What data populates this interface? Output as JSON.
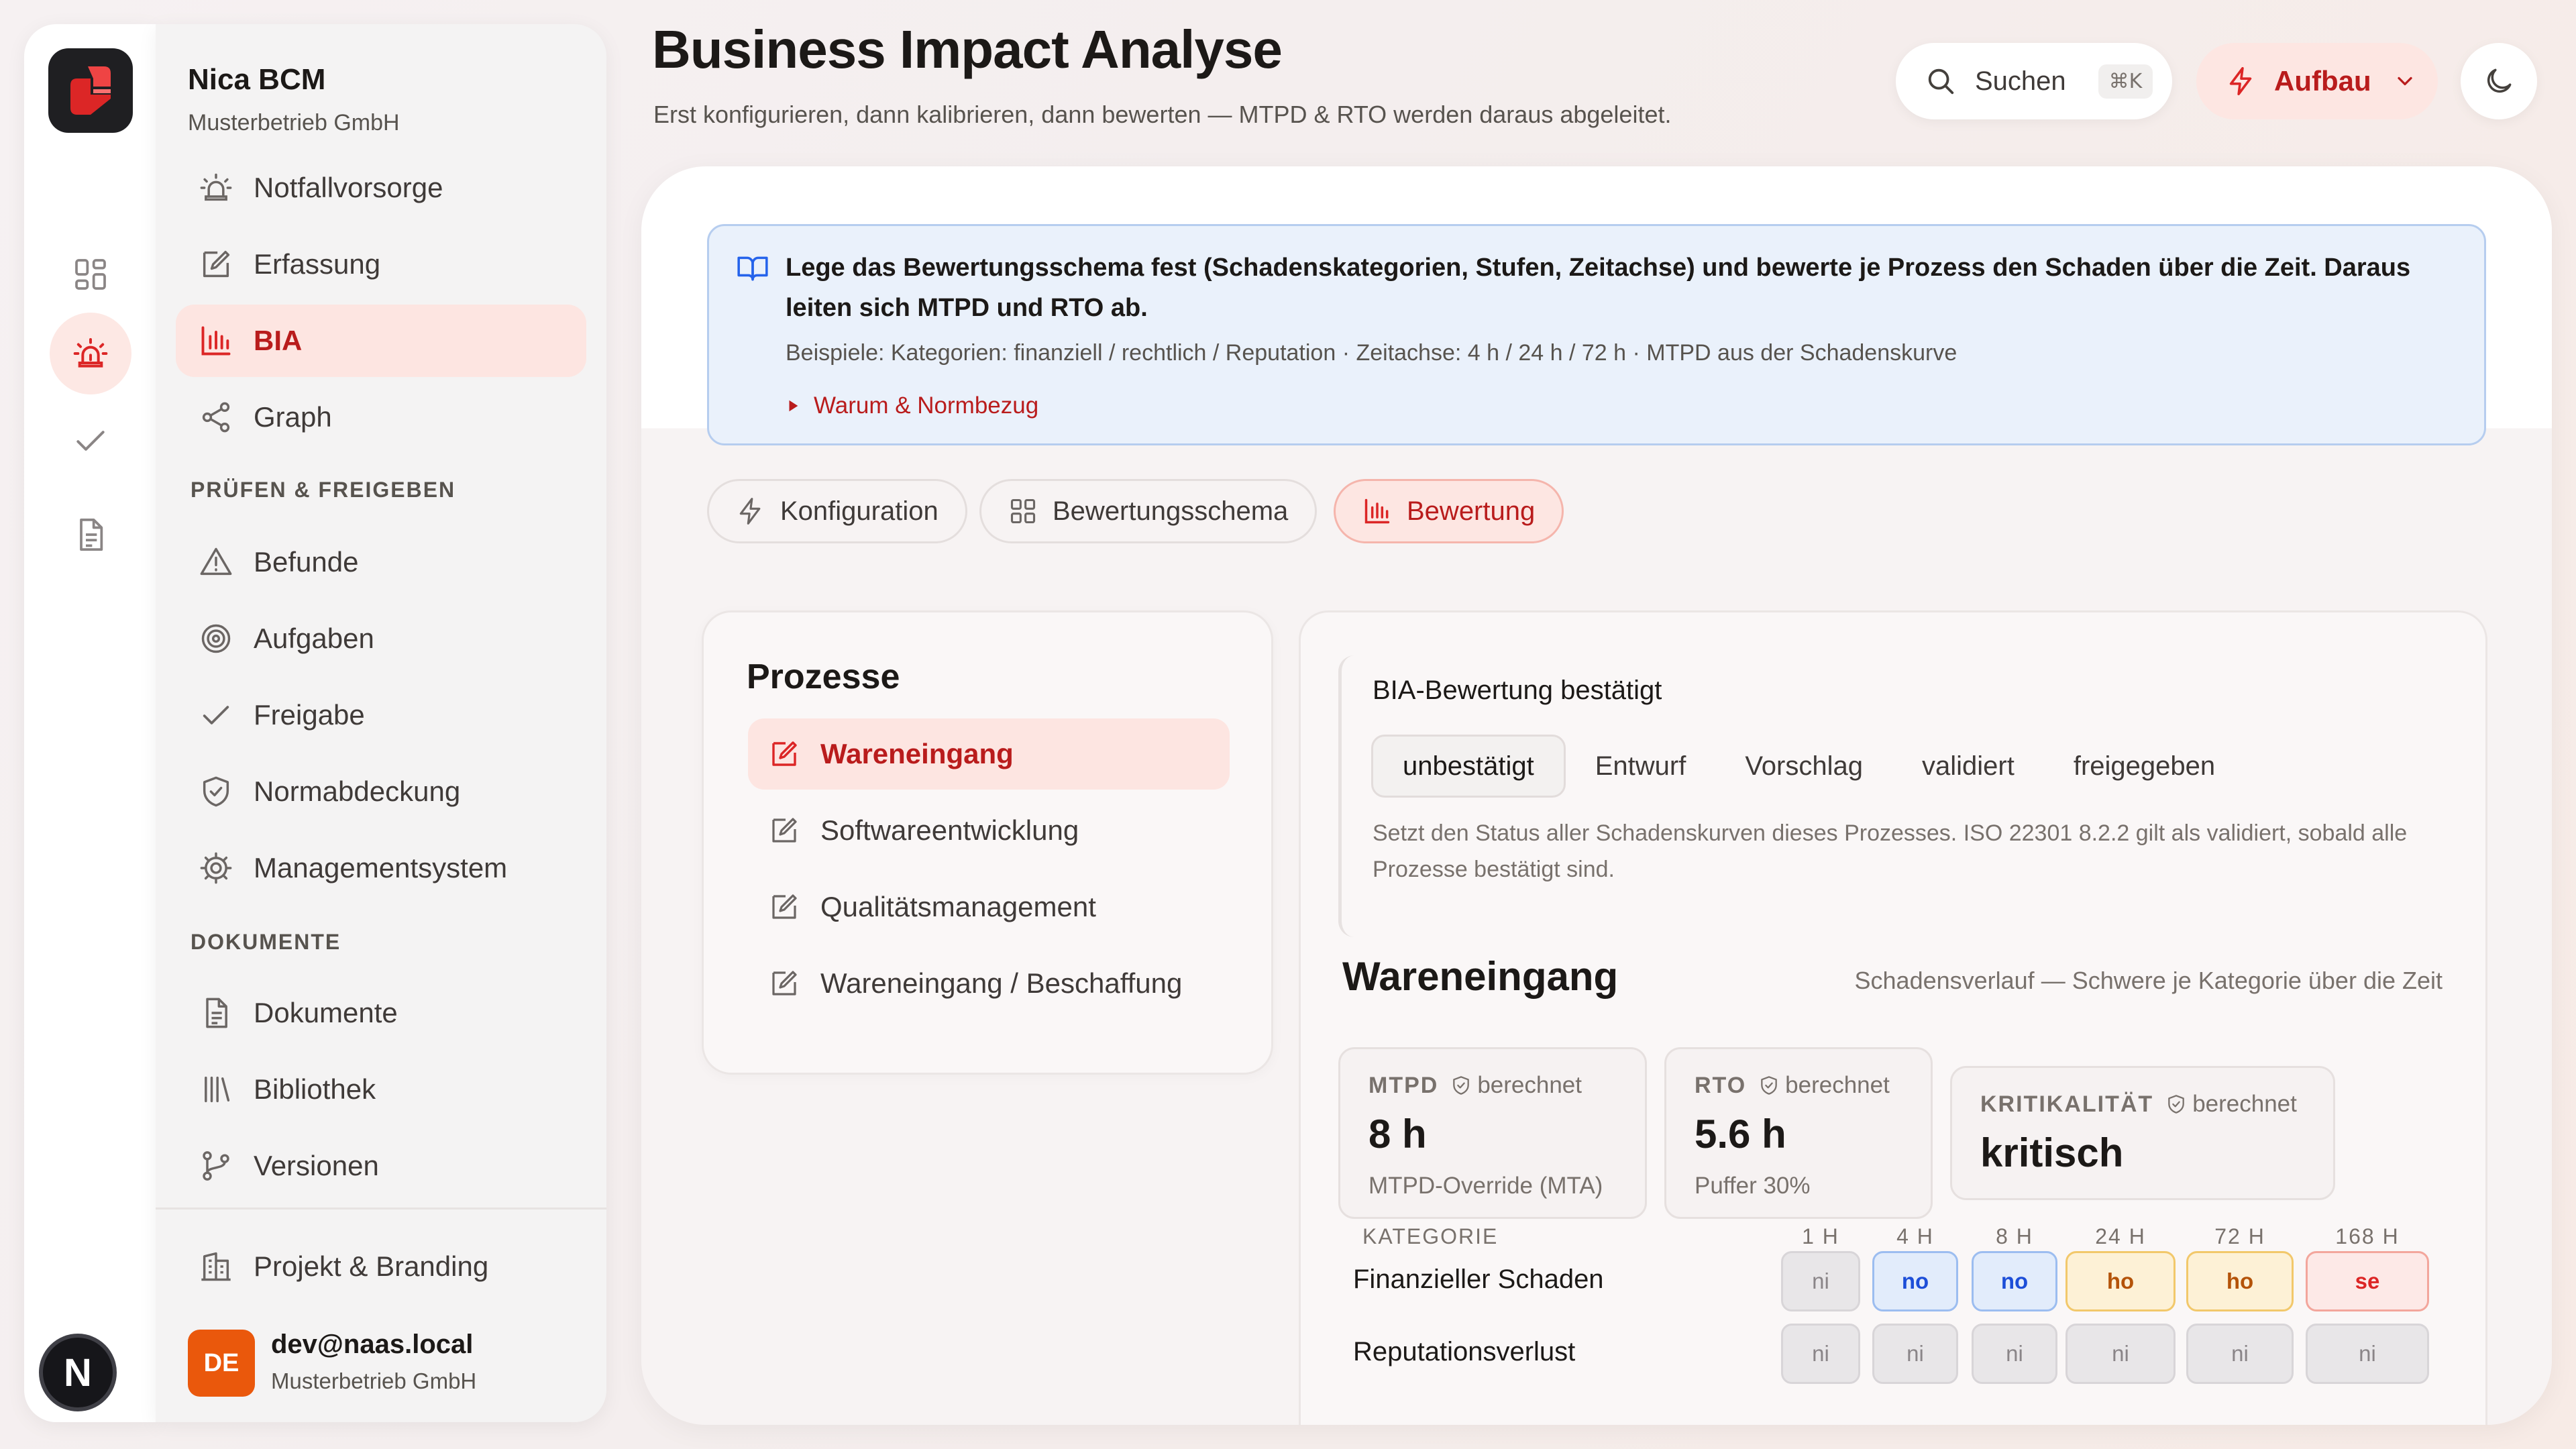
{
  "sidebar": {
    "brand_name": "Nica BCM",
    "brand_sub": "Musterbetrieb GmbH",
    "items_top": [
      {
        "label": "Notfallvorsorge",
        "icon": "alarm-icon"
      },
      {
        "label": "Erfassung",
        "icon": "edit-icon"
      },
      {
        "label": "BIA",
        "icon": "chart-bar-icon"
      },
      {
        "label": "Graph",
        "icon": "share-graph-icon"
      }
    ],
    "section_review": "PRÜFEN & FREIGEBEN",
    "items_review": [
      {
        "label": "Befunde",
        "icon": "warning-icon"
      },
      {
        "label": "Aufgaben",
        "icon": "target-icon"
      },
      {
        "label": "Freigabe",
        "icon": "check-icon"
      },
      {
        "label": "Normabdeckung",
        "icon": "shield-check-icon"
      },
      {
        "label": "Managementsystem",
        "icon": "gear-icon"
      }
    ],
    "section_docs": "DOKUMENTE",
    "items_docs": [
      {
        "label": "Dokumente",
        "icon": "document-icon"
      },
      {
        "label": "Bibliothek",
        "icon": "library-icon"
      },
      {
        "label": "Versionen",
        "icon": "git-branch-icon"
      }
    ],
    "project": {
      "label": "Projekt & Branding",
      "icon": "building-icon"
    },
    "user": {
      "initials": "DE",
      "email": "dev@naas.local",
      "org": "Musterbetrieb GmbH"
    }
  },
  "rail": {
    "avatar_letter": "N",
    "icons": [
      "grid-icon",
      "alarm-icon",
      "check-icon",
      "document-icon"
    ]
  },
  "header": {
    "title": "Business Impact Analyse",
    "subtitle": "Erst konfigurieren, dann kalibrieren, dann bewerten — MTPD & RTO werden daraus abgeleitet.",
    "search_label": "Suchen",
    "search_shortcut": "⌘K",
    "mode_label": "Aufbau"
  },
  "info": {
    "title": "Lege das Bewertungsschema fest (Schadenskategorien, Stufen, Zeitachse) und bewerte je Prozess den Schaden über die Zeit. Daraus leiten sich MTPD und RTO ab.",
    "example": "Beispiele: Kategorien: finanziell / rechtlich / Reputation · Zeitachse: 4 h / 24 h / 72 h · MTPD aus der Schadenskurve",
    "link": "Warum & Normbezug"
  },
  "tabs": [
    {
      "label": "Konfiguration",
      "icon": "bolt-icon"
    },
    {
      "label": "Bewertungsschema",
      "icon": "grid-icon"
    },
    {
      "label": "Bewertung",
      "icon": "chart-bar-icon"
    }
  ],
  "processes": {
    "title": "Prozesse",
    "items": [
      "Wareneingang",
      "Softwareentwicklung",
      "Qualitätsmanagement",
      "Wareneingang / Beschaffung"
    ]
  },
  "confirmation": {
    "title": "BIA-Bewertung bestätigt",
    "options": [
      "unbestätigt",
      "Entwurf",
      "Vorschlag",
      "validiert",
      "freigegeben"
    ],
    "selected": "unbestätigt",
    "note": "Setzt den Status aller Schadenskurven dieses Prozesses. ISO 22301 8.2.2 gilt als validiert, sobald alle Prozesse bestätigt sind."
  },
  "detail": {
    "title": "Wareneingang",
    "hint": "Schadensverlauf — Schwere je Kategorie über die Zeit",
    "calc_label": "berechnet",
    "mtpd": {
      "label": "MTPD",
      "value": "8 h",
      "note": "MTPD-Override (MTA)"
    },
    "rto": {
      "label": "RTO",
      "value": "5.6 h",
      "note": "Puffer 30%"
    },
    "criticality": {
      "label": "KRITIKALITÄT",
      "value": "kritisch"
    }
  },
  "matrix": {
    "category_header": "KATEGORIE",
    "time_headers": [
      "1 H",
      "4 H",
      "8 H",
      "24 H",
      "72 H",
      "168 H"
    ],
    "rows": [
      {
        "label": "Finanzieller Schaden",
        "cells": [
          "ni",
          "no",
          "no",
          "ho",
          "ho",
          "se"
        ]
      },
      {
        "label": "Reputationsverlust",
        "cells": [
          "ni",
          "ni",
          "ni",
          "ni",
          "ni",
          "ni"
        ]
      }
    ],
    "level_colors": {
      "ni": "#e8e6e8",
      "no": "#e2ecfb",
      "ho": "#fdf1d6",
      "se": "#fde9e7"
    }
  },
  "colors": {
    "accent": "#dc2626",
    "accent_bg": "#fde5e1",
    "info_bg": "#eaf1fb"
  }
}
